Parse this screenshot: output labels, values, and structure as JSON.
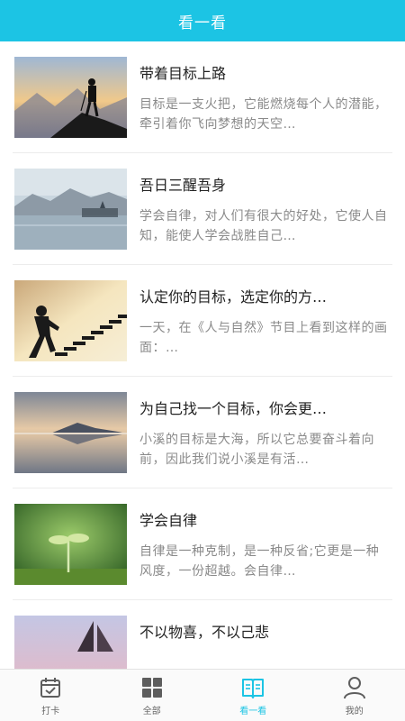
{
  "header": {
    "title": "看一看"
  },
  "articles": [
    {
      "title": "带着目标上路",
      "desc": "目标是一支火把，它能燃烧每个人的潜能，牵引着你飞向梦想的天空…",
      "image": "mountain-climber"
    },
    {
      "title": "吾日三醒吾身",
      "desc": "学会自律，对人们有很大的好处，它使人自知，能使人学会战胜自己…",
      "image": "misty-lake"
    },
    {
      "title": "认定你的目标，选定你的方…",
      "desc": "一天，在《人与自然》节目上看到这样的画面：…",
      "image": "stairs-climber"
    },
    {
      "title": "为自己找一个目标，你会更…",
      "desc": "小溪的目标是大海，所以它总要奋斗着向前，因此我们说小溪是有活…",
      "image": "mountain-reflection"
    },
    {
      "title": "学会自律",
      "desc": "自律是一种克制，是一种反省;它更是一种风度，一份超越。会自律…",
      "image": "sprout"
    },
    {
      "title": "不以物喜，不以己悲",
      "desc": "",
      "image": "sailboat"
    }
  ],
  "tabbar": {
    "items": [
      {
        "label": "打卡",
        "icon": "calendar-check-icon",
        "active": false
      },
      {
        "label": "全部",
        "icon": "grid-icon",
        "active": false
      },
      {
        "label": "看一看",
        "icon": "book-icon",
        "active": true
      },
      {
        "label": "我的",
        "icon": "user-icon",
        "active": false
      }
    ]
  },
  "colors": {
    "accent": "#1cc4e4",
    "inactive": "#666666"
  }
}
